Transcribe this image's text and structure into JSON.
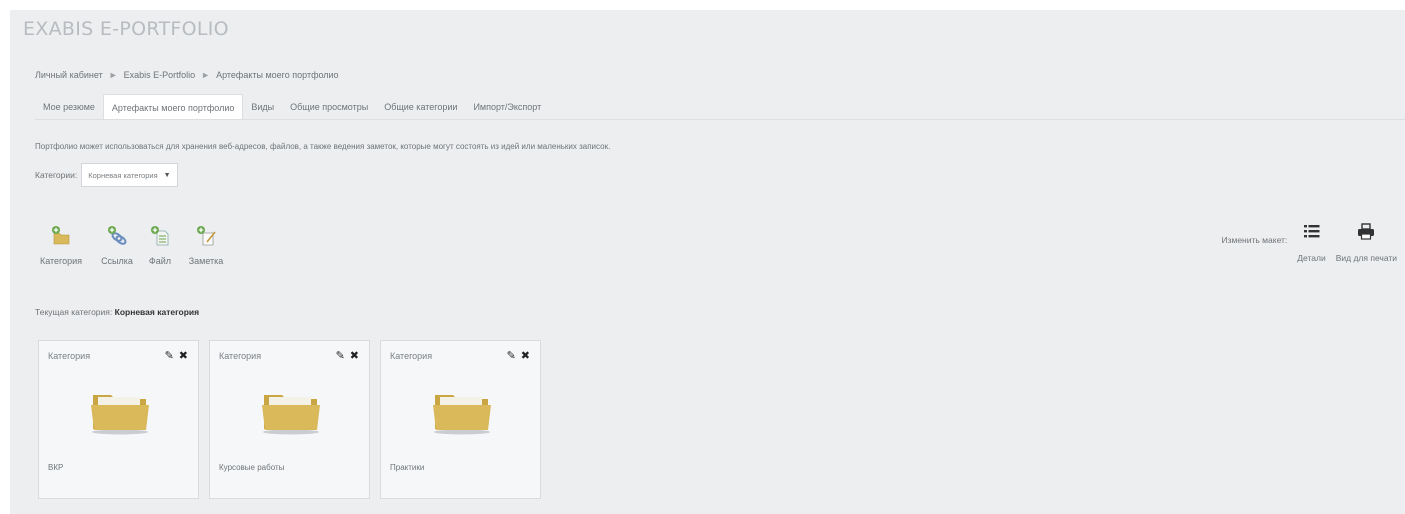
{
  "app_title": "EXABIS E-PORTFOLIO",
  "breadcrumb": [
    "Личный кабинет",
    "Exabis E-Portfolio",
    "Артефакты моего портфолио"
  ],
  "tabs": [
    {
      "label": "Мое резюме",
      "active": false
    },
    {
      "label": "Артефакты моего портфолио",
      "active": true
    },
    {
      "label": "Виды",
      "active": false
    },
    {
      "label": "Общие просмотры",
      "active": false
    },
    {
      "label": "Общие категории",
      "active": false
    },
    {
      "label": "Импорт/Экспорт",
      "active": false
    }
  ],
  "intro_text": "Портфолио может использоваться для хранения веб-адресов, файлов, а также ведения заметок, которые могут состоять из идей или маленьких записок.",
  "category_filter": {
    "label": "Категории:",
    "selected": "Корневая категория"
  },
  "add_tools": [
    {
      "icon": "add-category-icon",
      "label": "Категория"
    },
    {
      "icon": "add-link-icon",
      "label": "Ссылка"
    },
    {
      "icon": "add-file-icon",
      "label": "Файл"
    },
    {
      "icon": "add-note-icon",
      "label": "Заметка"
    }
  ],
  "layout_tools": {
    "label": "Изменить макет:",
    "details": {
      "icon": "list-icon",
      "label": "Детали"
    },
    "print": {
      "icon": "printer-icon",
      "label": "Вид для печати"
    }
  },
  "current_category": {
    "label": "Текущая категория:",
    "value": "Корневая категория"
  },
  "cards": [
    {
      "type": "Категория",
      "name": "ВКР",
      "icon": "folder-icon"
    },
    {
      "type": "Категория",
      "name": "Курсовые работы",
      "icon": "folder-icon"
    },
    {
      "type": "Категория",
      "name": "Практики",
      "icon": "folder-icon"
    }
  ],
  "colors": {
    "panel_bg": "#eceef0",
    "folder": "#d9b95a",
    "add_green": "#6aa84f"
  }
}
